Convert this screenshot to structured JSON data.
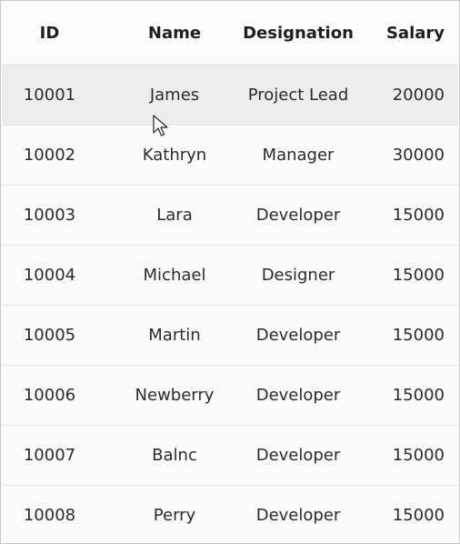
{
  "columns": {
    "id": "ID",
    "name": "Name",
    "designation": "Designation",
    "salary": "Salary"
  },
  "rows": [
    {
      "id": "10001",
      "name": "James",
      "designation": "Project Lead",
      "salary": "20000"
    },
    {
      "id": "10002",
      "name": "Kathryn",
      "designation": "Manager",
      "salary": "30000"
    },
    {
      "id": "10003",
      "name": "Lara",
      "designation": "Developer",
      "salary": "15000"
    },
    {
      "id": "10004",
      "name": "Michael",
      "designation": "Designer",
      "salary": "15000"
    },
    {
      "id": "10005",
      "name": "Martin",
      "designation": "Developer",
      "salary": "15000"
    },
    {
      "id": "10006",
      "name": "Newberry",
      "designation": "Developer",
      "salary": "15000"
    },
    {
      "id": "10007",
      "name": "Balnc",
      "designation": "Developer",
      "salary": "15000"
    },
    {
      "id": "10008",
      "name": "Perry",
      "designation": "Developer",
      "salary": "15000"
    }
  ],
  "colors": {
    "hover_row": "#ededed",
    "row_background": "#fbfbfb",
    "grid_line": "#e4e4e4",
    "text": "#2b2b2b"
  },
  "icons": {
    "cursor": "mouse-pointer-icon"
  }
}
